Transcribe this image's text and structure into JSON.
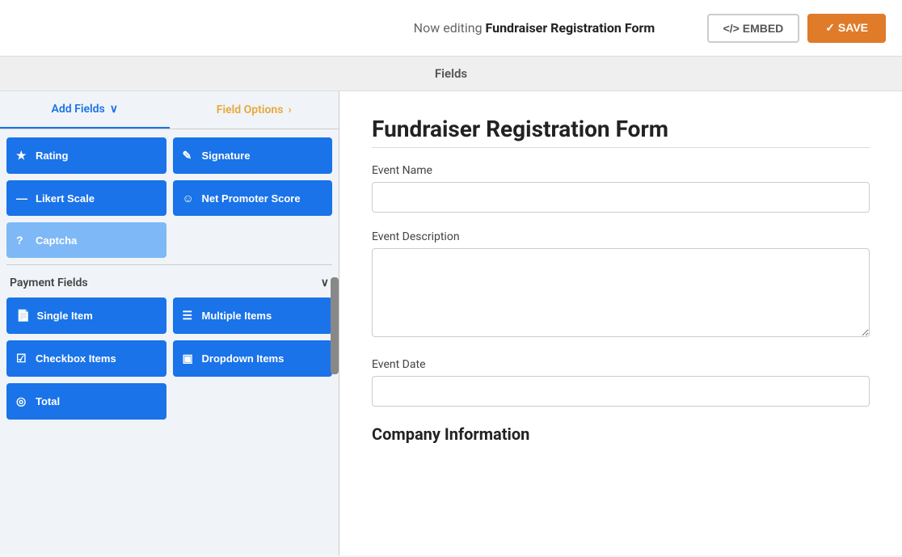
{
  "header": {
    "editing_text": "Now editing",
    "form_name": "Fundraiser Registration Form",
    "embed_label": "</> EMBED",
    "save_label": "✓ SAVE"
  },
  "fields_header": {
    "label": "Fields"
  },
  "sidebar": {
    "tab_add": "Add Fields",
    "tab_add_arrow": "∨",
    "tab_options": "Field Options",
    "tab_options_arrow": "›",
    "field_buttons_top": [
      {
        "icon": "★",
        "label": "Rating",
        "style": "normal"
      },
      {
        "icon": "✎",
        "label": "Signature",
        "style": "normal"
      },
      {
        "icon": "—",
        "label": "Likert Scale",
        "style": "normal"
      },
      {
        "icon": "☺",
        "label": "Net Promoter Score",
        "style": "normal"
      },
      {
        "icon": "?",
        "label": "Captcha",
        "style": "light"
      }
    ],
    "payment_section": "Payment Fields",
    "payment_buttons": [
      {
        "icon": "📄",
        "label": "Single Item",
        "style": "normal"
      },
      {
        "icon": "☰",
        "label": "Multiple Items",
        "style": "normal"
      },
      {
        "icon": "☑",
        "label": "Checkbox Items",
        "style": "normal"
      },
      {
        "icon": "▣",
        "label": "Dropdown Items",
        "style": "normal"
      },
      {
        "icon": "◎",
        "label": "Total",
        "style": "normal"
      }
    ]
  },
  "form": {
    "title": "Fundraiser Registration Form",
    "fields": [
      {
        "label": "Event Name",
        "type": "input",
        "placeholder": ""
      },
      {
        "label": "Event Description",
        "type": "textarea",
        "placeholder": ""
      },
      {
        "label": "Event Date",
        "type": "input",
        "placeholder": ""
      }
    ],
    "section_title": "Company Information"
  }
}
